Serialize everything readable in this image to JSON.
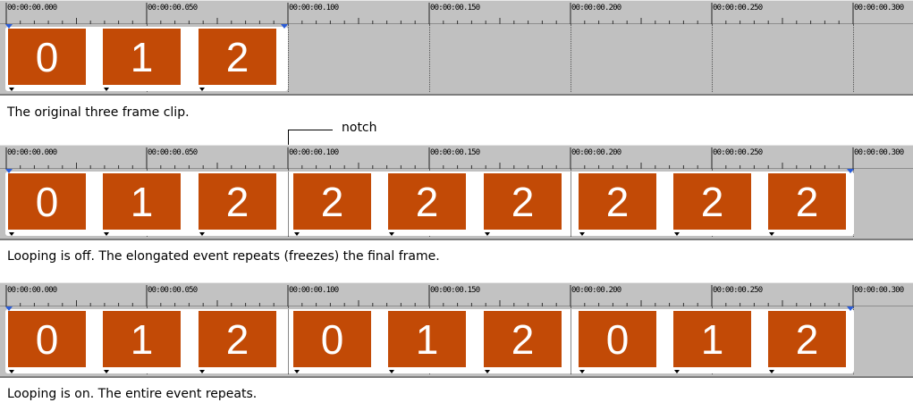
{
  "timeline": {
    "ruler_labels": [
      "00:00:00.000",
      "00:00:00.050",
      "00:00:00.100",
      "00:00:00.150",
      "00:00:00.200",
      "00:00:00.250",
      "00:00:00.300"
    ]
  },
  "strips": [
    {
      "frames": [
        "0",
        "1",
        "2"
      ],
      "caption": "The original three frame clip."
    },
    {
      "frames": [
        "0",
        "1",
        "2",
        "2",
        "2",
        "2",
        "2",
        "2",
        "2"
      ],
      "caption": "Looping is off. The elongated event repeats (freezes) the final frame."
    },
    {
      "frames": [
        "0",
        "1",
        "2",
        "0",
        "1",
        "2",
        "0",
        "1",
        "2"
      ],
      "caption": "Looping is on. The entire event repeats."
    }
  ],
  "callout": {
    "label": "notch"
  },
  "colors": {
    "frame": "#c24a06",
    "track": "#c0c0c0",
    "ruler": "#c2c2c2"
  }
}
